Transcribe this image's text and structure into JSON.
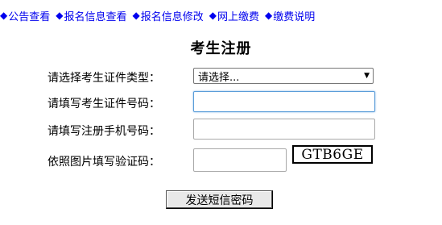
{
  "nav": {
    "items": [
      {
        "bullet": "◆",
        "label": "公告查看"
      },
      {
        "bullet": "◆",
        "label": "报名信息查看"
      },
      {
        "bullet": "◆",
        "label": "报名信息修改"
      },
      {
        "bullet": "◆",
        "label": "网上缴费"
      },
      {
        "bullet": "◆",
        "label": "缴费说明"
      }
    ]
  },
  "title": "考生注册",
  "form": {
    "id_type_label": "请选择考生证件类型：",
    "id_type_selected": "请选择...",
    "id_number_label": "请填写考生证件号码：",
    "phone_label": "请填写注册手机号码：",
    "captcha_label": "依照图片填写验证码：",
    "captcha_text": "GTB6GE",
    "send_button": "发送短信密码"
  }
}
